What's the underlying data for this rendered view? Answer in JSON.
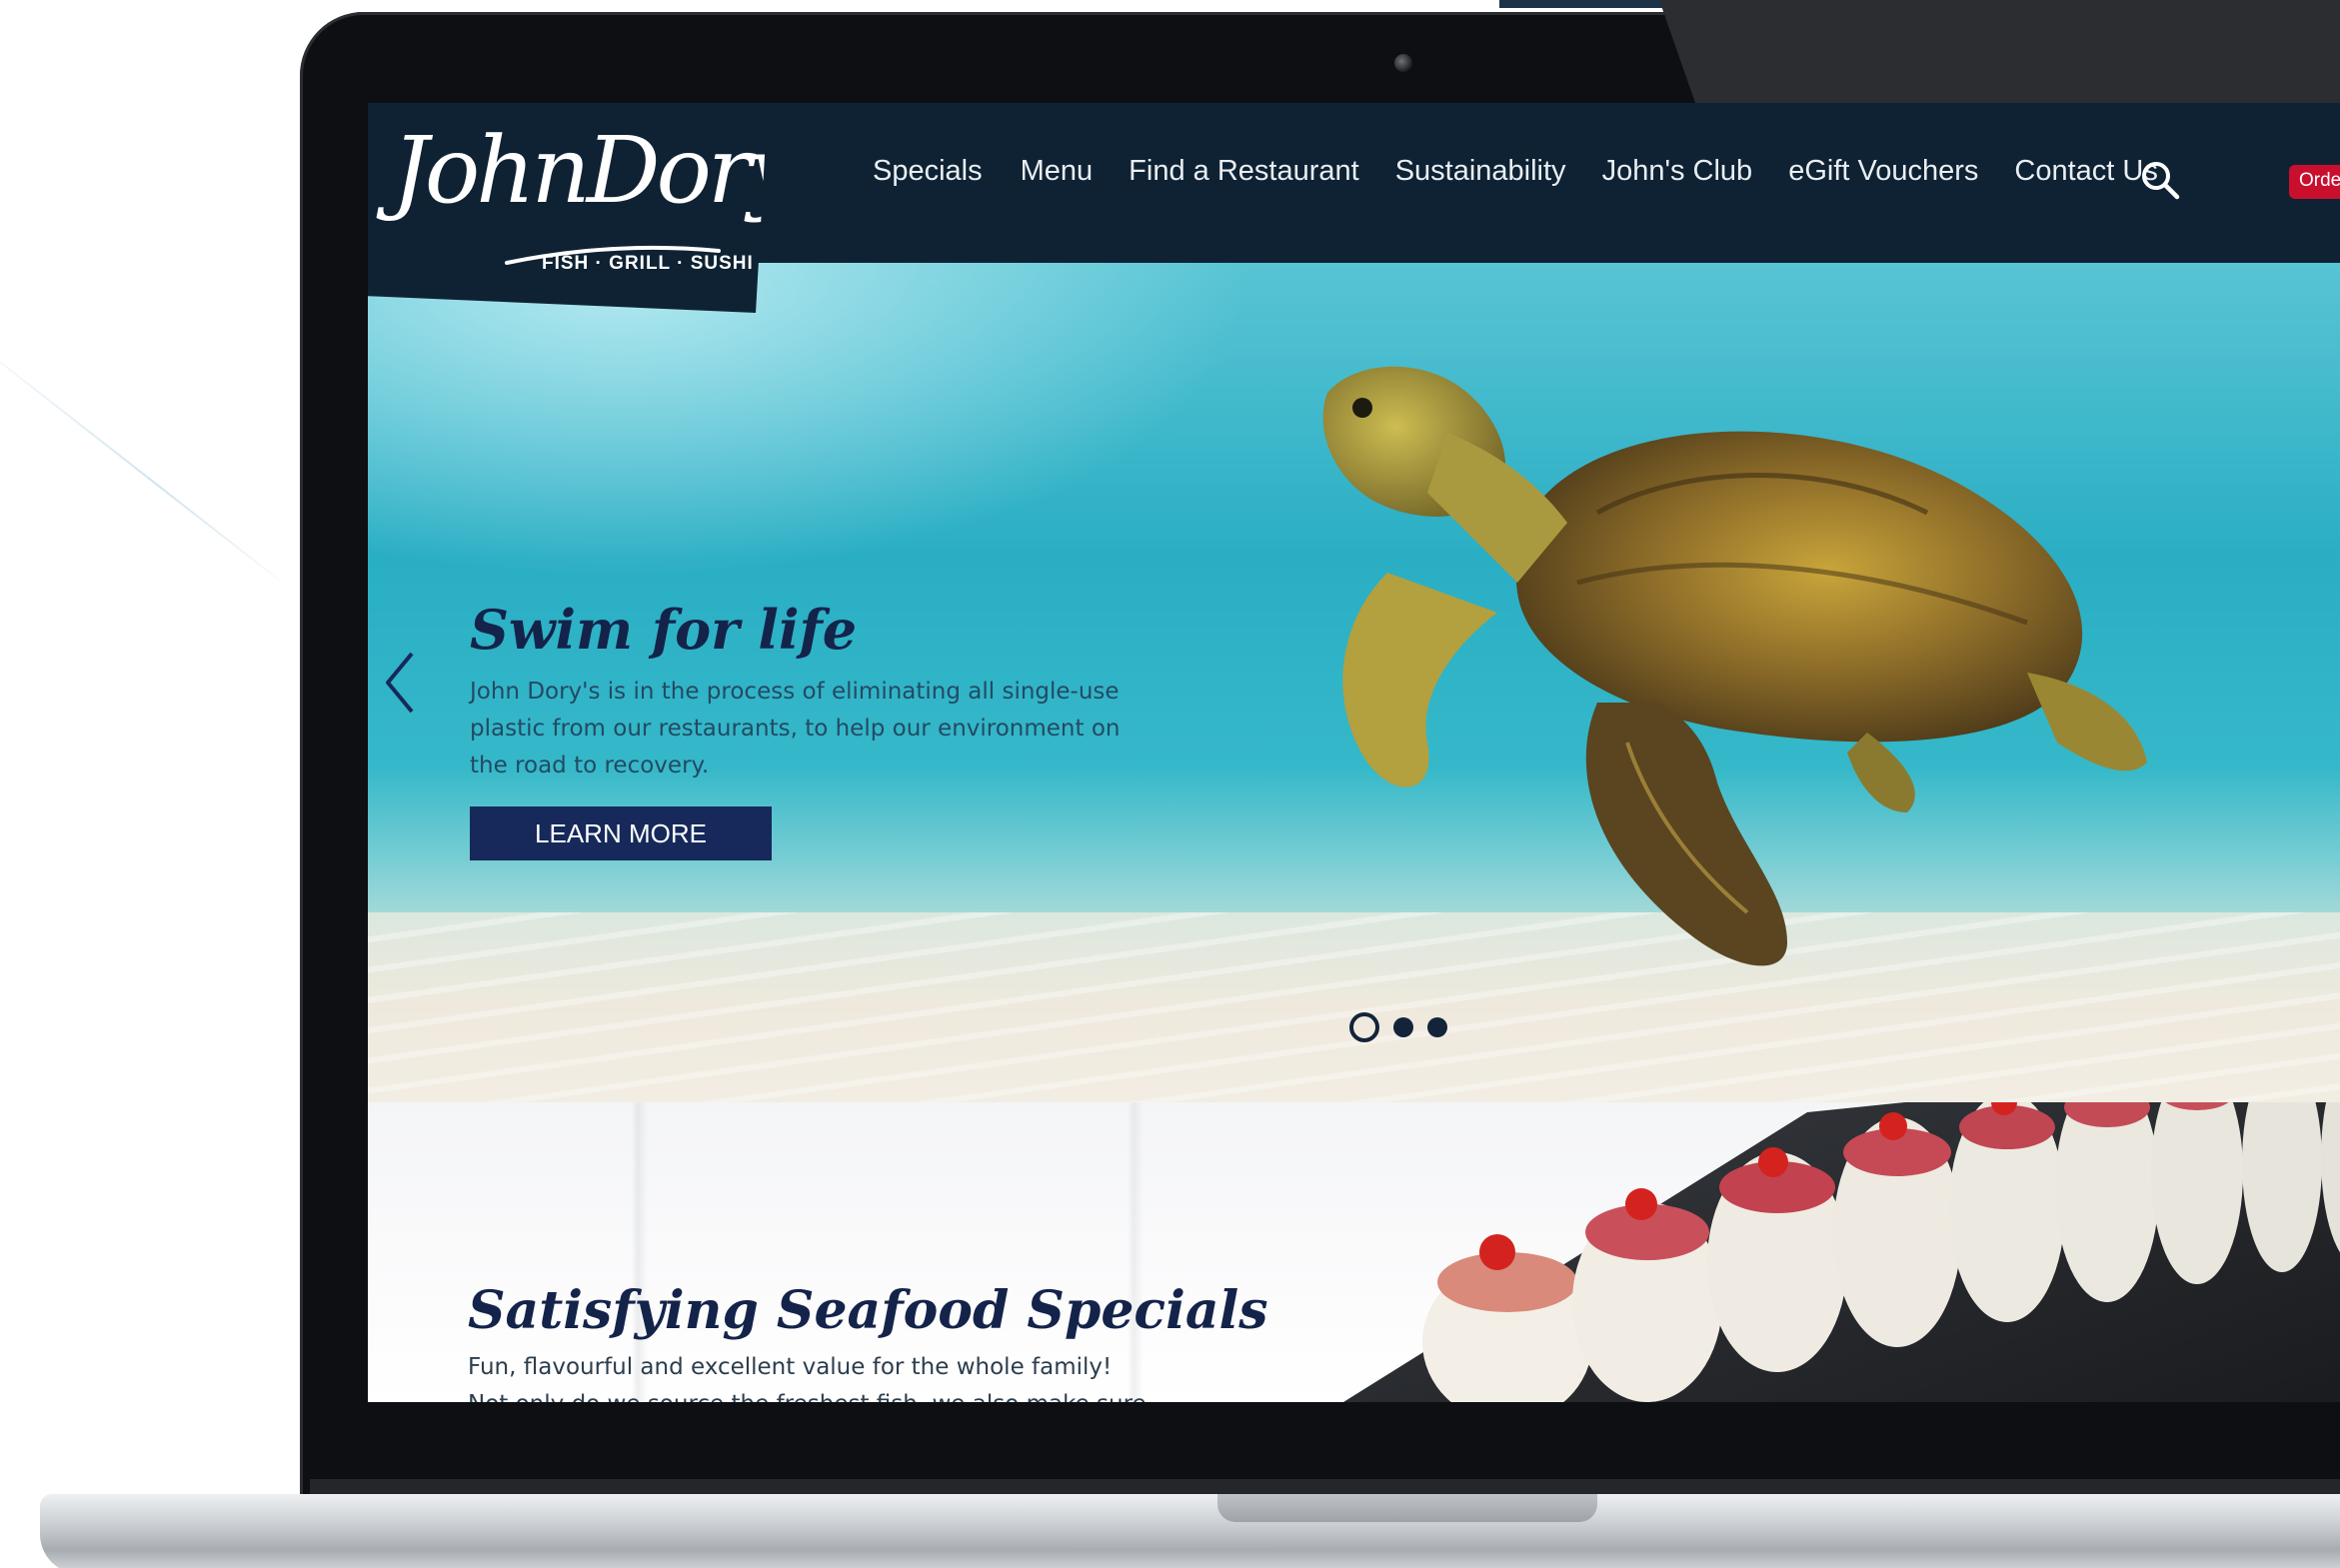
{
  "site": {
    "logo": {
      "script": "JohnDory's",
      "tagline": "FISH · GRILL · SUSHI"
    },
    "nav": {
      "items": [
        {
          "label": "Specials"
        },
        {
          "label": "Menu"
        },
        {
          "label": "Find a Restaurant"
        },
        {
          "label": "Sustainability"
        },
        {
          "label": "John's Club"
        },
        {
          "label": "eGift Vouchers"
        },
        {
          "label": "Contact Us"
        }
      ],
      "search_icon": "search-icon",
      "order_label": "Order"
    },
    "hero": {
      "title": "Swim for life",
      "text": "John Dory's is in the process of eliminating all single-use plastic from our restaurants, to help our environment on the road to recovery.",
      "button": "LEARN MORE",
      "prev_icon": "chevron-left-icon",
      "slides": 3,
      "active_slide": 1
    },
    "specials": {
      "title": "Satisfying Seafood Specials",
      "text": "Fun, flavourful and excellent value for the whole family! Not only do we source the freshest fish, we also make sure we take special care of you. View our scrumptious seafood specials here."
    }
  },
  "colors": {
    "nav_bg": "#0f2233",
    "brand_navy": "#14234a",
    "button_navy": "#16295a",
    "order_red": "#c8102e",
    "water": "#2aaec4"
  }
}
